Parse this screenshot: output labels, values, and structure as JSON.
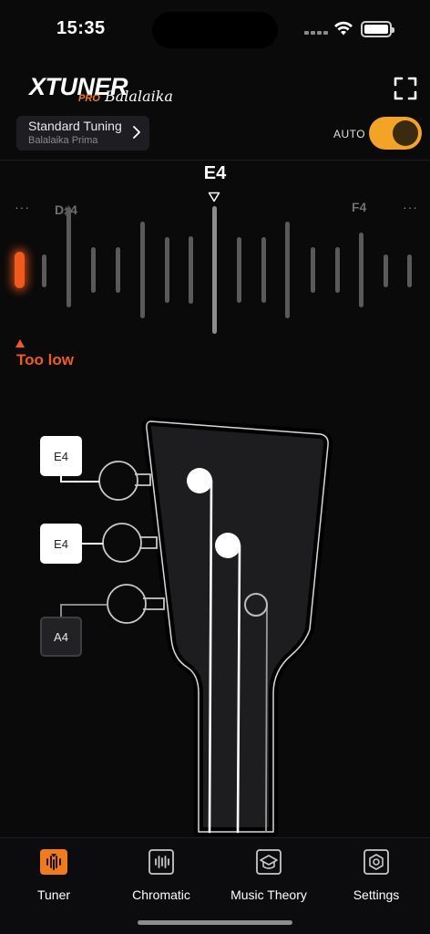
{
  "status_bar": {
    "time": "15:35"
  },
  "app": {
    "logo_main": "XTUNER",
    "logo_pro": "PRO",
    "logo_sub": "Balalaika",
    "accent_color": "#f3a325",
    "alert_color": "#f05a22"
  },
  "tuning": {
    "name": "Standard Tuning",
    "instrument": "Balalaika Prima"
  },
  "auto": {
    "label": "AUTO",
    "enabled": true
  },
  "meter": {
    "target_note": "E4",
    "left_note": "D♯4",
    "right_note": "F4",
    "more_left": "···",
    "more_right": "···",
    "status": "Too low"
  },
  "strings": [
    {
      "note": "E4",
      "selected": true
    },
    {
      "note": "E4",
      "selected": true
    },
    {
      "note": "A4",
      "selected": false
    }
  ],
  "tabs": [
    {
      "label": "Tuner",
      "icon": "tuner-icon",
      "active": true
    },
    {
      "label": "Chromatic",
      "icon": "chromatic-icon",
      "active": false
    },
    {
      "label": "Music Theory",
      "icon": "music-theory-icon",
      "active": false
    },
    {
      "label": "Settings",
      "icon": "settings-icon",
      "active": false
    }
  ]
}
